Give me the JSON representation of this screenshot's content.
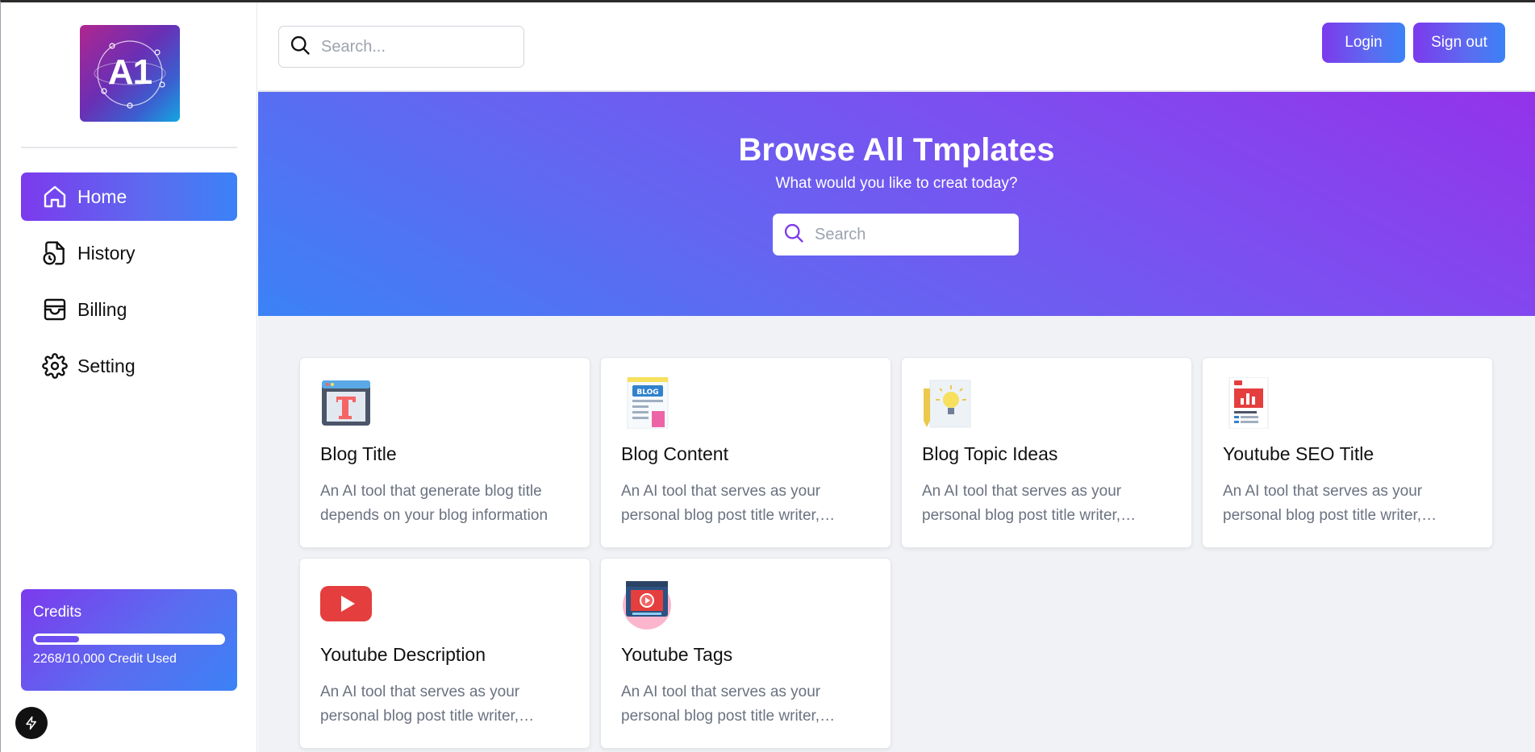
{
  "logo": {
    "text": "A1",
    "icon": "ai-orbit-logo"
  },
  "sidebar": {
    "items": [
      {
        "label": "Home",
        "icon": "home-icon",
        "active": true
      },
      {
        "label": "History",
        "icon": "history-icon",
        "active": false
      },
      {
        "label": "Billing",
        "icon": "billing-icon",
        "active": false
      },
      {
        "label": "Setting",
        "icon": "gear-icon",
        "active": false
      }
    ]
  },
  "credits": {
    "title": "Credits",
    "used_text": "2268/10,000 Credit Used",
    "used_fraction": 0.2268
  },
  "header": {
    "search_placeholder": "Search...",
    "login_label": "Login",
    "signout_label": "Sign out"
  },
  "hero": {
    "title": "Browse All Tmplates",
    "subtitle": "What would you like to creat today?",
    "search_placeholder": "Search"
  },
  "templates": [
    {
      "title": "Blog Title",
      "description": "An AI tool that generate blog title depends on your blog information",
      "icon": "blog-title-icon"
    },
    {
      "title": "Blog Content",
      "description": "An AI tool that serves as your personal blog post title writer, generating catchy and viral-worthy titles",
      "icon": "blog-content-icon"
    },
    {
      "title": "Blog Topic Ideas",
      "description": "An AI tool that serves as your personal blog post title writer, generating catchy and viral-worthy titles",
      "icon": "lightbulb-idea-icon"
    },
    {
      "title": "Youtube SEO Title",
      "description": "An AI tool that serves as your personal blog post title writer, generating catchy and viral-worthy titles",
      "icon": "seo-chart-icon"
    },
    {
      "title": "Youtube Description",
      "description": "An AI tool that serves as your personal blog post title writer, generating catchy and viral-worthy titles",
      "icon": "youtube-icon"
    },
    {
      "title": "Youtube Tags",
      "description": "An AI tool that serves as your personal blog post title writer, generating catchy and viral-worthy titles",
      "icon": "video-tags-icon"
    }
  ],
  "colors": {
    "accent_start": "#7c3aed",
    "accent_end": "#3b82f6",
    "content_bg": "#f0f2f5"
  }
}
